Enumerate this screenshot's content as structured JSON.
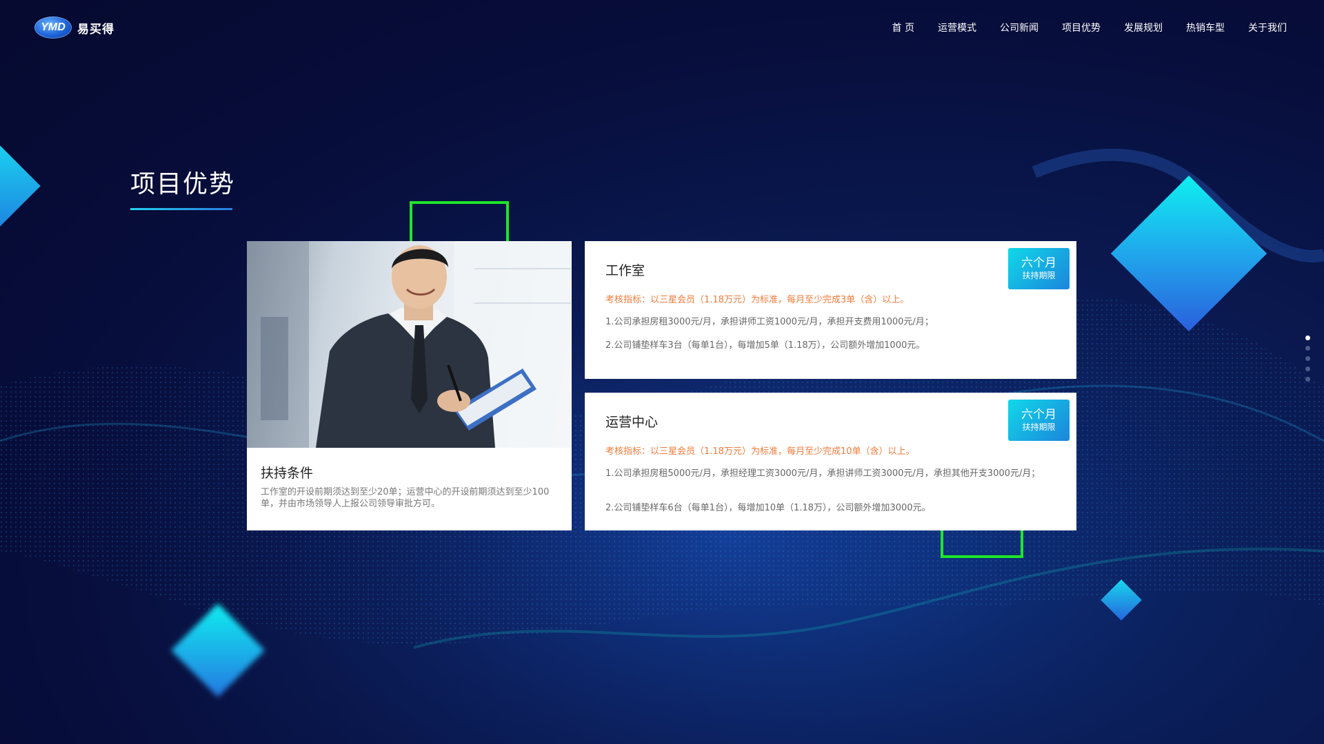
{
  "header": {
    "logo_badge": "YMD",
    "logo_name": "易买得",
    "nav": [
      "首 页",
      "运营模式",
      "公司新闻",
      "项目优势",
      "发展规划",
      "热销车型",
      "关于我们"
    ]
  },
  "section": {
    "title": "项目优势"
  },
  "support_card": {
    "title": "扶持条件",
    "text": "工作室的开设前期须达到至少20单；运营中心的开设前期须达到至少100单，并由市场领导人上报公司领导审批方可。"
  },
  "plans": [
    {
      "title": "工作室",
      "indicator": "考核指标：以三星会员（1.18万元）为标准，每月至少完成3单（含）以上。",
      "items": [
        "1.公司承担房租3000元/月，承担讲师工资1000元/月，承担开支费用1000元/月；",
        "2.公司铺垫样车3台（每单1台），每增加5单（1.18万），公司额外增加1000元。"
      ],
      "badge_main": "六个月",
      "badge_sub": "扶持期限"
    },
    {
      "title": "运营中心",
      "indicator": "考核指标：以三星会员（1.18万元）为标准，每月至少完成10单（含）以上。",
      "items": [
        "1.公司承担房租5000元/月，承担经理工资3000元/月，承担讲师工资3000元/月，承担其他开支3000元/月；",
        "2.公司铺垫样车6台（每单1台），每增加10单（1.18万），公司额外增加3000元。"
      ],
      "badge_main": "六个月",
      "badge_sub": "扶持期限"
    }
  ],
  "pagination": {
    "count": 5,
    "active": 0
  },
  "colors": {
    "background": "#070d3a",
    "accent_cyan": "#12d8e8",
    "accent_blue": "#1b85dc",
    "outline_green": "#1ee628",
    "indicator_orange": "#f07a3a"
  },
  "icons": [
    "logo-badge",
    "businessman-photo",
    "diamond-decoration",
    "page-dot"
  ]
}
